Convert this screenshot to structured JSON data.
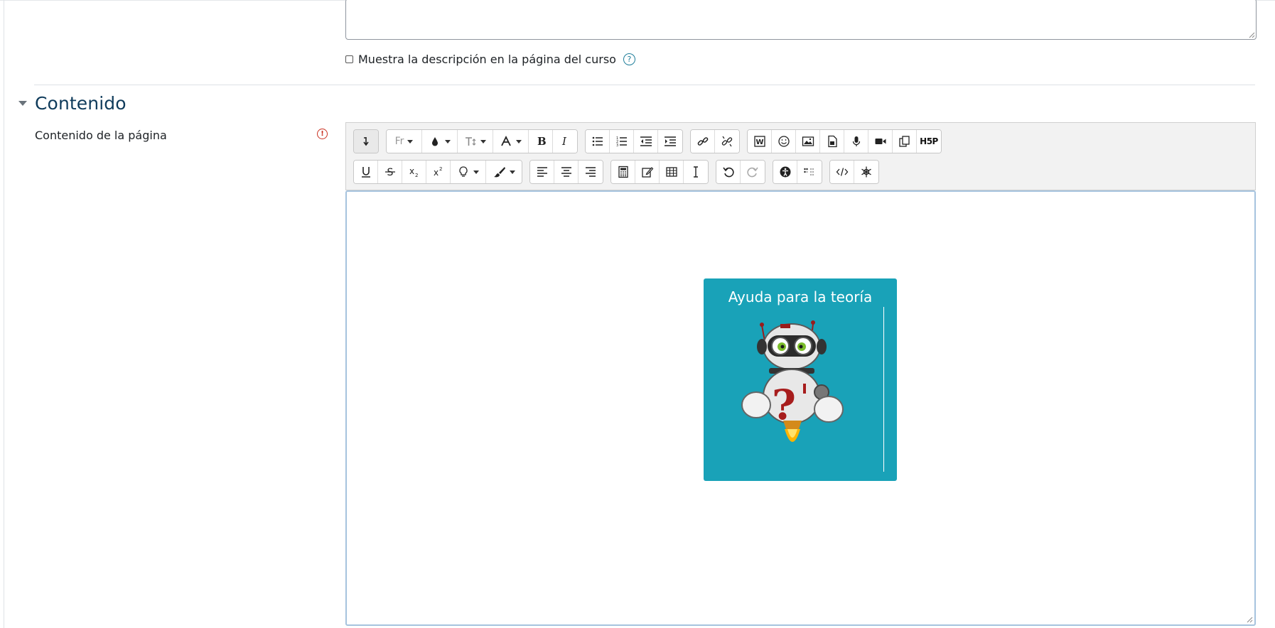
{
  "description": {
    "show_on_course_label": "Muestra la descripción en la página del curso",
    "show_on_course_checked": false,
    "help_icon": "question-circle-icon"
  },
  "section": {
    "title": "Contenido",
    "collapse_icon": "caret-down-icon"
  },
  "field": {
    "label": "Contenido de la página",
    "required_icon": "exclamation-circle-icon"
  },
  "toolbar": {
    "font_family_label": "Fr",
    "h5p_label": "H5P"
  },
  "h5p_card": {
    "title": "Ayuda para la teoría",
    "background": "#19a2b8",
    "image": "robot-question-icon"
  },
  "colors": {
    "section_title": "#0f3b5b",
    "required": "#ca3120",
    "help": "#1f7e9a",
    "editor_focus_border": "#a6c3de"
  }
}
